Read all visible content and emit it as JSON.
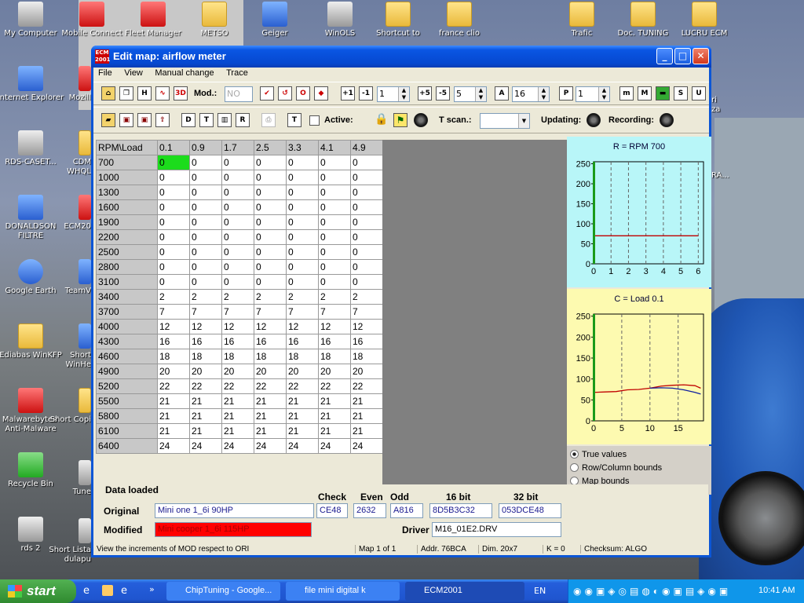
{
  "desktop": {
    "icons_top": [
      "My Computer",
      "Mobile Connect",
      "Fleet Manager",
      "METSO",
      "Geiger",
      "WinOLS",
      "Shortcut to",
      "france clio",
      "Trafic",
      "Doc. TUNING",
      "LUCRU ECM"
    ],
    "icons_left": [
      "Internet Explorer",
      "RDS-CASET...",
      "DONALDSON FILTRE",
      "Google Earth",
      "Ediabas WinKFP",
      "Malwarebytes' Anti-Malware",
      "Recycle Bin",
      "rds 2"
    ],
    "icons_partial": [
      "Mozill",
      "CDM WHQL",
      "ECM20",
      "TeamV",
      "Short WinHe",
      "Short Copi",
      "Tune",
      "Short Lista dulapu"
    ],
    "partial_right": [
      "ri",
      "za",
      "RA..."
    ]
  },
  "window": {
    "title": "Edit map: airflow meter",
    "icon_text": "ECM 2001",
    "controls": [
      "_",
      "□",
      "✕"
    ]
  },
  "menu": [
    "File",
    "View",
    "Manual change",
    "Trace"
  ],
  "toolbar1": {
    "mod_label": "Mod.:",
    "mod_value": "NO",
    "spin1": "1",
    "spin2": "5",
    "spin3": "16",
    "spin4": "1",
    "btn_labels": [
      "H",
      "3D",
      "O",
      "+1",
      "-1",
      "+5",
      "-5",
      "A",
      "P",
      "m",
      "M",
      "S",
      "U"
    ]
  },
  "toolbar2": {
    "active_label": "Active:",
    "tscan_label": "T scan.:",
    "updating_label": "Updating:",
    "recording_label": "Recording:",
    "btn_labels": [
      "D",
      "T",
      "R",
      "T"
    ]
  },
  "table": {
    "corner": "RPM\\Load",
    "cols": [
      "0.1",
      "0.9",
      "1.7",
      "2.5",
      "3.3",
      "4.1",
      "4.9"
    ],
    "rows": [
      {
        "rpm": "700",
        "v": [
          "0",
          "0",
          "0",
          "0",
          "0",
          "0",
          "0"
        ]
      },
      {
        "rpm": "1000",
        "v": [
          "0",
          "0",
          "0",
          "0",
          "0",
          "0",
          "0"
        ]
      },
      {
        "rpm": "1300",
        "v": [
          "0",
          "0",
          "0",
          "0",
          "0",
          "0",
          "0"
        ]
      },
      {
        "rpm": "1600",
        "v": [
          "0",
          "0",
          "0",
          "0",
          "0",
          "0",
          "0"
        ]
      },
      {
        "rpm": "1900",
        "v": [
          "0",
          "0",
          "0",
          "0",
          "0",
          "0",
          "0"
        ]
      },
      {
        "rpm": "2200",
        "v": [
          "0",
          "0",
          "0",
          "0",
          "0",
          "0",
          "0"
        ]
      },
      {
        "rpm": "2500",
        "v": [
          "0",
          "0",
          "0",
          "0",
          "0",
          "0",
          "0"
        ]
      },
      {
        "rpm": "2800",
        "v": [
          "0",
          "0",
          "0",
          "0",
          "0",
          "0",
          "0"
        ]
      },
      {
        "rpm": "3100",
        "v": [
          "0",
          "0",
          "0",
          "0",
          "0",
          "0",
          "0"
        ]
      },
      {
        "rpm": "3400",
        "v": [
          "2",
          "2",
          "2",
          "2",
          "2",
          "2",
          "2"
        ]
      },
      {
        "rpm": "3700",
        "v": [
          "7",
          "7",
          "7",
          "7",
          "7",
          "7",
          "7"
        ]
      },
      {
        "rpm": "4000",
        "v": [
          "12",
          "12",
          "12",
          "12",
          "12",
          "12",
          "12"
        ]
      },
      {
        "rpm": "4300",
        "v": [
          "16",
          "16",
          "16",
          "16",
          "16",
          "16",
          "16"
        ]
      },
      {
        "rpm": "4600",
        "v": [
          "18",
          "18",
          "18",
          "18",
          "18",
          "18",
          "18"
        ]
      },
      {
        "rpm": "4900",
        "v": [
          "20",
          "20",
          "20",
          "20",
          "20",
          "20",
          "20"
        ]
      },
      {
        "rpm": "5200",
        "v": [
          "22",
          "22",
          "22",
          "22",
          "22",
          "22",
          "22"
        ]
      },
      {
        "rpm": "5500",
        "v": [
          "21",
          "21",
          "21",
          "21",
          "21",
          "21",
          "21"
        ]
      },
      {
        "rpm": "5800",
        "v": [
          "21",
          "21",
          "21",
          "21",
          "21",
          "21",
          "21"
        ]
      },
      {
        "rpm": "6100",
        "v": [
          "21",
          "21",
          "21",
          "21",
          "21",
          "21",
          "21"
        ]
      },
      {
        "rpm": "6400",
        "v": [
          "24",
          "24",
          "24",
          "24",
          "24",
          "24",
          "24"
        ]
      }
    ],
    "selected_color": "#1cdc1c"
  },
  "chart_data": [
    {
      "type": "line",
      "title": "R = RPM 700",
      "bg": "#b8f6f8",
      "x": [
        0,
        1,
        2,
        3,
        4,
        5,
        6
      ],
      "xticks": [
        "0",
        "1",
        "2",
        "3",
        "4",
        "5",
        "6"
      ],
      "yticks": [
        "0",
        "50",
        "100",
        "150",
        "200",
        "250"
      ],
      "ylim": [
        0,
        255
      ],
      "xlim": [
        0,
        6.3
      ],
      "series": [
        {
          "color": "#c00000",
          "x": [
            0,
            6
          ],
          "y": [
            70,
            70
          ]
        }
      ],
      "cursor_x": 0,
      "grid": "vertical dashed"
    },
    {
      "type": "line",
      "title": "C = Load 0.1",
      "bg": "#fdfab0",
      "xticks": [
        "0",
        "5",
        "10",
        "15"
      ],
      "xvals": [
        0,
        5,
        10,
        15
      ],
      "yticks": [
        "0",
        "50",
        "100",
        "150",
        "200",
        "250"
      ],
      "ylim": [
        0,
        255
      ],
      "xlim": [
        0,
        19.5
      ],
      "series": [
        {
          "color": "#c00000",
          "x": [
            0,
            2,
            4,
            6,
            8,
            10,
            12,
            14,
            16,
            18,
            19
          ],
          "y": [
            68,
            69,
            70,
            74,
            75,
            78,
            83,
            85,
            86,
            84,
            78
          ]
        },
        {
          "color": "#1020a0",
          "x": [
            10,
            12,
            14,
            16,
            18,
            19
          ],
          "y": [
            78,
            79,
            78,
            74,
            68,
            64
          ]
        }
      ],
      "cursor_x": 0,
      "grid": "vertical dashed"
    }
  ],
  "view_options": {
    "items": [
      "True values",
      "Row/Column bounds",
      "Map bounds"
    ],
    "selected": 0
  },
  "data_panel": {
    "title": "Data loaded",
    "original_label": "Original",
    "modified_label": "Modified",
    "original_value": "Mini one 1_6i 90HP",
    "modified_value": "Mini cooper 1_6i 115HP",
    "check_label": "Check",
    "even_label": "Even",
    "odd_label": "Odd",
    "bit16_label": "16 bit",
    "bit32_label": "32 bit",
    "check_value": "CE48",
    "even_value": "2632",
    "odd_value": "A816",
    "bit16_value": "8D5B3C32",
    "bit32_value": "053DCE48",
    "driver_label": "Driver",
    "driver_value": "M16_01E2.DRV",
    "modified_color": "#ff0000"
  },
  "statusbar": {
    "hint": "View the increments of MOD respect to ORI",
    "map": "Map 1 of 1",
    "addr": "Addr. 76BCA",
    "dim": "Dim. 20x7",
    "k": "K = 0",
    "checksum": "Checksum: ALGO"
  },
  "taskbar": {
    "start": "start",
    "tasks": [
      "ChipTuning - Google...",
      "file mini digital k",
      "ECM2001"
    ],
    "lang": "EN",
    "clock": "10:41 AM"
  }
}
